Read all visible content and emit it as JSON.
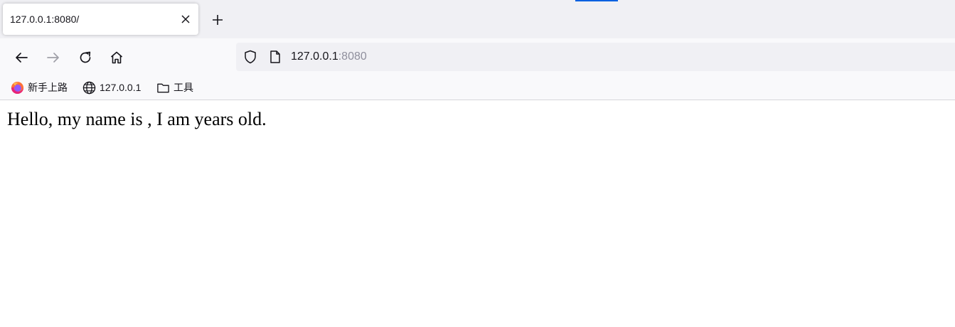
{
  "tab": {
    "title": "127.0.0.1:8080/"
  },
  "address": {
    "host": "127.0.0.1",
    "port": ":8080"
  },
  "bookmarks": [
    {
      "label": "新手上路",
      "icon": "firefox-icon"
    },
    {
      "label": "127.0.0.1",
      "icon": "globe-icon"
    },
    {
      "label": "工具",
      "icon": "folder-icon"
    }
  ],
  "page": {
    "text": "Hello, my name is , I am years old."
  },
  "colors": {
    "accent": "#0061e0",
    "tabbar": "#f0f0f4",
    "toolbar": "#f9f9fb"
  }
}
